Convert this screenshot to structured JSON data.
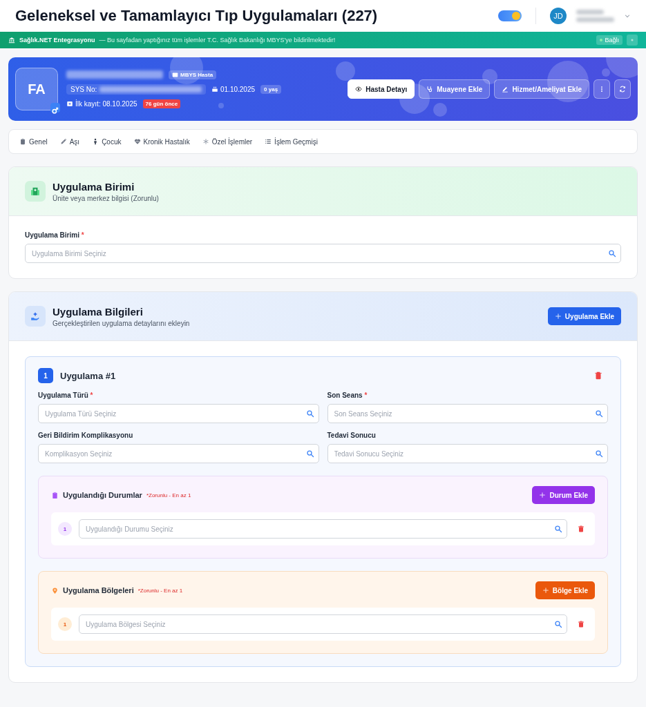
{
  "header": {
    "title": "Geleneksel ve Tamamlayıcı Tıp Uygulamaları (227)",
    "theme_toggle": {
      "on": true
    },
    "user_initials": "JD"
  },
  "integration_bar": {
    "title": "Sağlık.NET Entegrasyonu",
    "message": "— Bu sayfadan yaptığınız tüm işlemler T.C. Sağlık Bakanlığı MBYS'ye bildirilmektedir!",
    "status": "Bağlı"
  },
  "patient": {
    "initials": "FA",
    "badge": "MBYS Hasta",
    "sys_label": "SYS No:",
    "birth_date": "01.10.2025",
    "age": "0 yaş",
    "first_record": "İlk kayıt: 08.10.2025",
    "days_ago": "76 gün önce",
    "actions": [
      {
        "label": "Hasta Detayı",
        "kind": "primary"
      },
      {
        "label": "Muayene Ekle",
        "kind": "secondary"
      },
      {
        "label": "Hizmet/Ameliyat Ekle",
        "kind": "secondary"
      }
    ]
  },
  "tabs": [
    {
      "label": "Genel"
    },
    {
      "label": "Aşı"
    },
    {
      "label": "Çocuk"
    },
    {
      "label": "Kronik Hastalık"
    },
    {
      "label": "Özel İşlemler"
    },
    {
      "label": "İşlem Geçmişi"
    }
  ],
  "unit_section": {
    "title": "Uygulama Birimi",
    "subtitle": "Ünite veya merkez bilgisi (Zorunlu)",
    "field": {
      "label": "Uygulama Birimi",
      "required_mark": "*",
      "placeholder": "Uygulama Birimi Seçiniz"
    }
  },
  "application_section": {
    "title": "Uygulama Bilgileri",
    "subtitle": "Gerçekleştirilen uygulama detaylarını ekleyin",
    "add_button": "Uygulama Ekle",
    "items": [
      {
        "number": "1",
        "title": "Uygulama #1",
        "fields": [
          {
            "label": "Uygulama Türü",
            "required_mark": "*",
            "placeholder": "Uygulama Türü Seçiniz"
          },
          {
            "label": "Son Seans",
            "required_mark": "*",
            "placeholder": "Son Seans Seçiniz"
          },
          {
            "label": "Geri Bildirim Komplikasyonu",
            "placeholder": "Komplikasyon Seçiniz"
          },
          {
            "label": "Tedavi Sonucu",
            "placeholder": "Tedavi Sonucu Seçiniz"
          }
        ],
        "groups": [
          {
            "kind": "conditions",
            "title": "Uygulandığı Durumlar",
            "note": "*Zorunlu - En az 1",
            "add_button": "Durum Ekle",
            "rows": [
              {
                "number": "1",
                "placeholder": "Uygulandığı Durumu Seçiniz"
              }
            ]
          },
          {
            "kind": "regions",
            "title": "Uygulama Bölgeleri",
            "note": "*Zorunlu - En az 1",
            "add_button": "Bölge Ekle",
            "rows": [
              {
                "number": "1",
                "placeholder": "Uygulama Bölgesi Seçiniz"
              }
            ]
          }
        ]
      }
    ]
  }
}
